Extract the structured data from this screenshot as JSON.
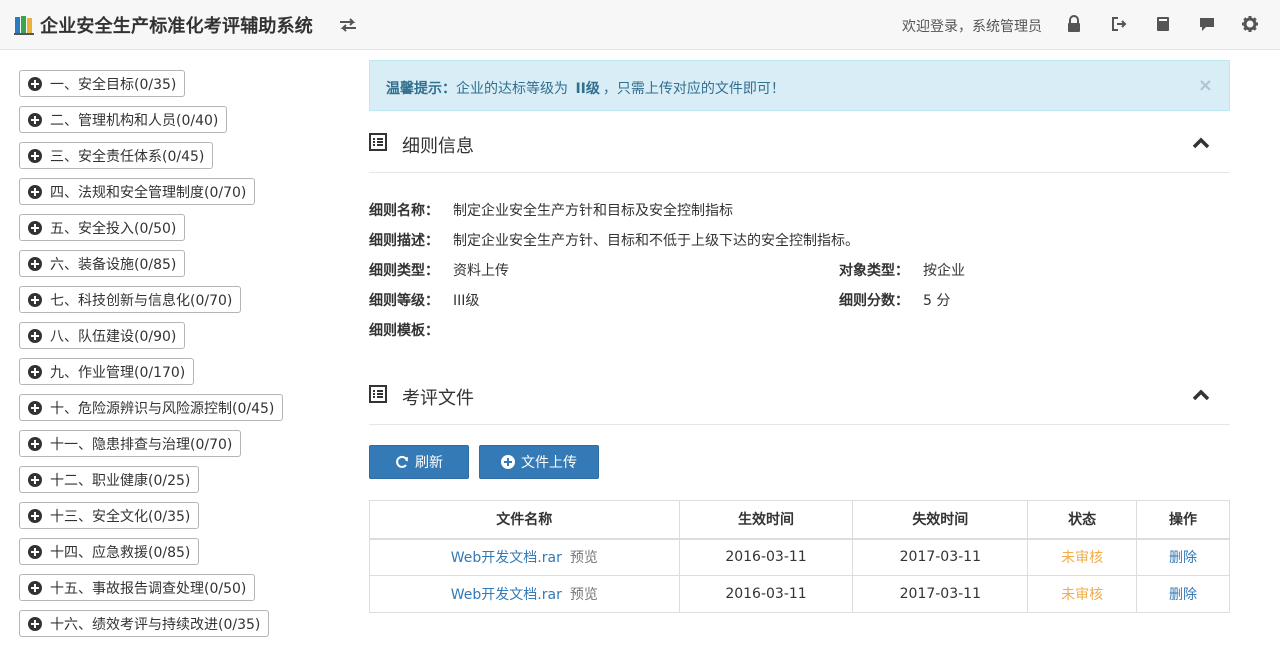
{
  "header": {
    "title": "企业安全生产标准化考评辅助系统",
    "welcome": "欢迎登录，系统管理员",
    "icons": [
      "swap-icon",
      "lock-icon",
      "logout-icon",
      "book-icon",
      "comment-icon",
      "gear-icon"
    ]
  },
  "sidebar": {
    "items": [
      {
        "label": "一、安全目标(0/35)"
      },
      {
        "label": "二、管理机构和人员(0/40)"
      },
      {
        "label": "三、安全责任体系(0/45)"
      },
      {
        "label": "四、法规和安全管理制度(0/70)"
      },
      {
        "label": "五、安全投入(0/50)"
      },
      {
        "label": "六、装备设施(0/85)"
      },
      {
        "label": "七、科技创新与信息化(0/70)"
      },
      {
        "label": "八、队伍建设(0/90)"
      },
      {
        "label": "九、作业管理(0/170)"
      },
      {
        "label": "十、危险源辨识与风险源控制(0/45)"
      },
      {
        "label": "十一、隐患排查与治理(0/70)"
      },
      {
        "label": "十二、职业健康(0/25)"
      },
      {
        "label": "十三、安全文化(0/35)"
      },
      {
        "label": "十四、应急救援(0/85)"
      },
      {
        "label": "十五、事故报告调查处理(0/50)"
      },
      {
        "label": "十六、绩效考评与持续改进(0/35)"
      }
    ]
  },
  "alert": {
    "prefix": "温馨提示：",
    "text1": "企业的达标等级为",
    "level": "II级",
    "text2": "，只需上传对应的文件即可！",
    "close": "×"
  },
  "detail_section": {
    "title": "细则信息",
    "name_label": "细则名称：",
    "name_value": "制定企业安全生产方针和目标及安全控制指标",
    "desc_label": "细则描述：",
    "desc_value": "制定企业安全生产方针、目标和不低于上级下达的安全控制指标。",
    "type_label": "细则类型：",
    "type_value": "资料上传",
    "object_label": "对象类型：",
    "object_value": "按企业",
    "grade_label": "细则等级：",
    "grade_value": "III级",
    "score_label": "细则分数：",
    "score_value": "5 分",
    "template_label": "细则模板："
  },
  "files_section": {
    "title": "考评文件",
    "refresh_label": "刷新",
    "upload_label": "文件上传",
    "columns": [
      "文件名称",
      "生效时间",
      "失效时间",
      "状态",
      "操作"
    ],
    "rows": [
      {
        "name": "Web开发文档.rar",
        "preview": "预览",
        "start": "2016-03-11",
        "end": "2017-03-11",
        "status": "未审核",
        "action": "删除"
      },
      {
        "name": "Web开发文档.rar",
        "preview": "预览",
        "start": "2016-03-11",
        "end": "2017-03-11",
        "status": "未审核",
        "action": "删除"
      }
    ]
  },
  "colors": {
    "primary": "#337ab7",
    "alert_bg": "#d9edf7",
    "alert_text": "#31708f",
    "status_pending": "#f0ad4e"
  }
}
